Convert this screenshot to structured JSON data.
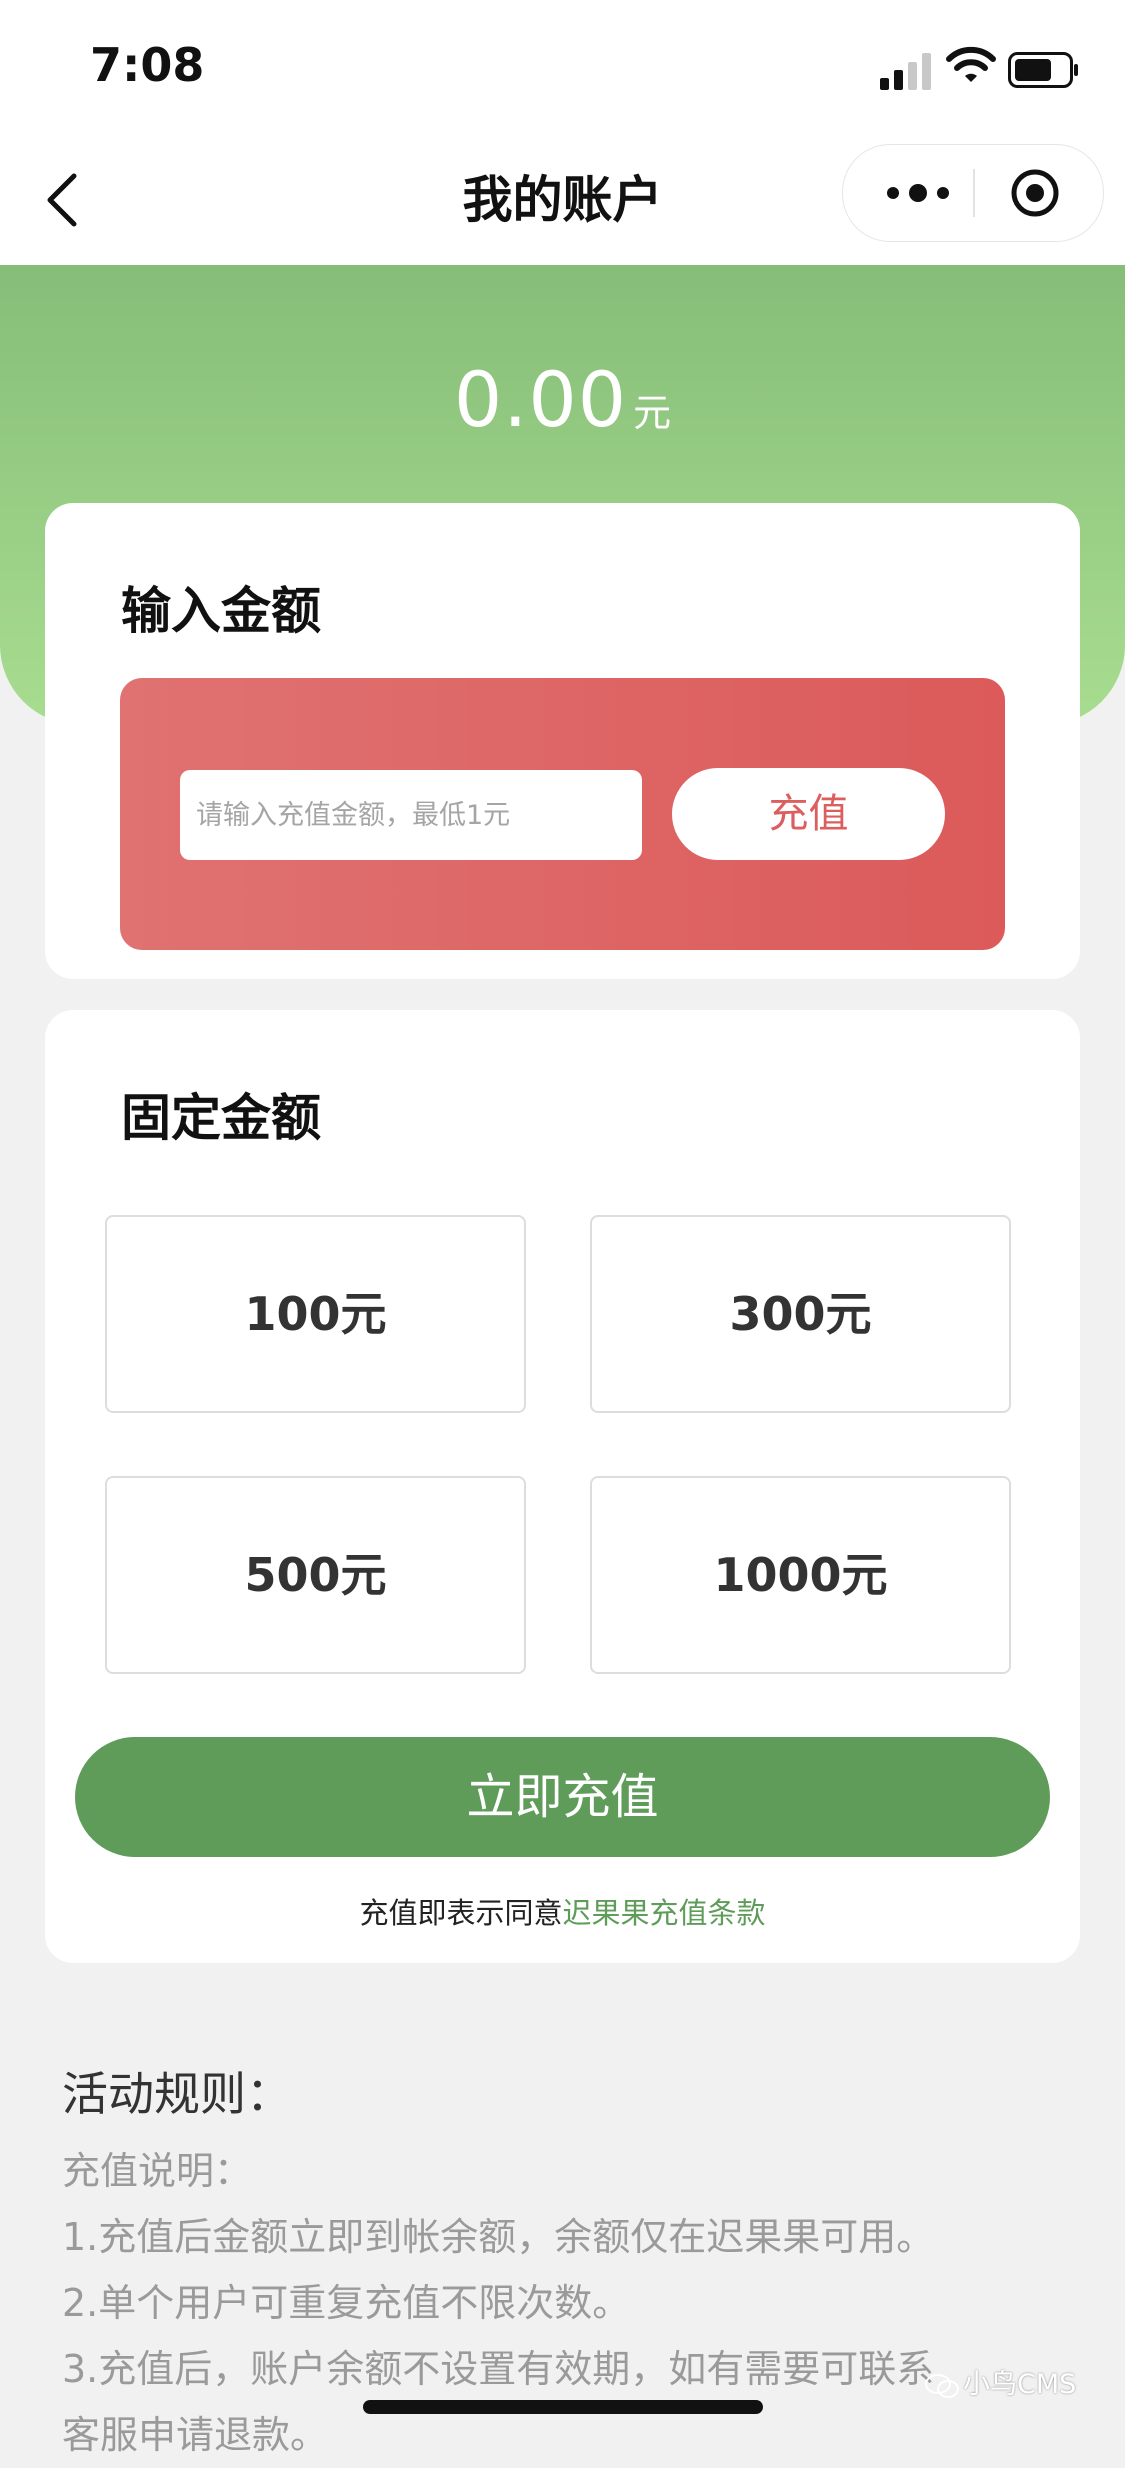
{
  "status_bar": {
    "time": "7:08"
  },
  "nav": {
    "title": "我的账户"
  },
  "balance": {
    "amount": "0.00",
    "unit": "元"
  },
  "input_section": {
    "title": "输入金额",
    "placeholder": "请输入充值金额，最低1元",
    "button": "充值"
  },
  "fixed_section": {
    "title": "固定金额",
    "options": [
      "100元",
      "300元",
      "500元",
      "1000元"
    ],
    "submit": "立即充值",
    "agreement_prefix": "充值即表示同意",
    "agreement_link": "迟果果充值条款"
  },
  "rules": {
    "title": "活动规则：",
    "lines": [
      "充值说明：",
      "1.充值后金额立即到帐余额，余额仅在迟果果可用。",
      "2.单个用户可重复充值不限次数。",
      "3.充值后，账户余额不设置有效期，如有需要可联系",
      "客服申请退款。"
    ]
  },
  "watermark": "小鸟CMS",
  "colors": {
    "green": "#5f9c5a",
    "red": "#dc5a5a",
    "header_green": "#86bd78"
  }
}
